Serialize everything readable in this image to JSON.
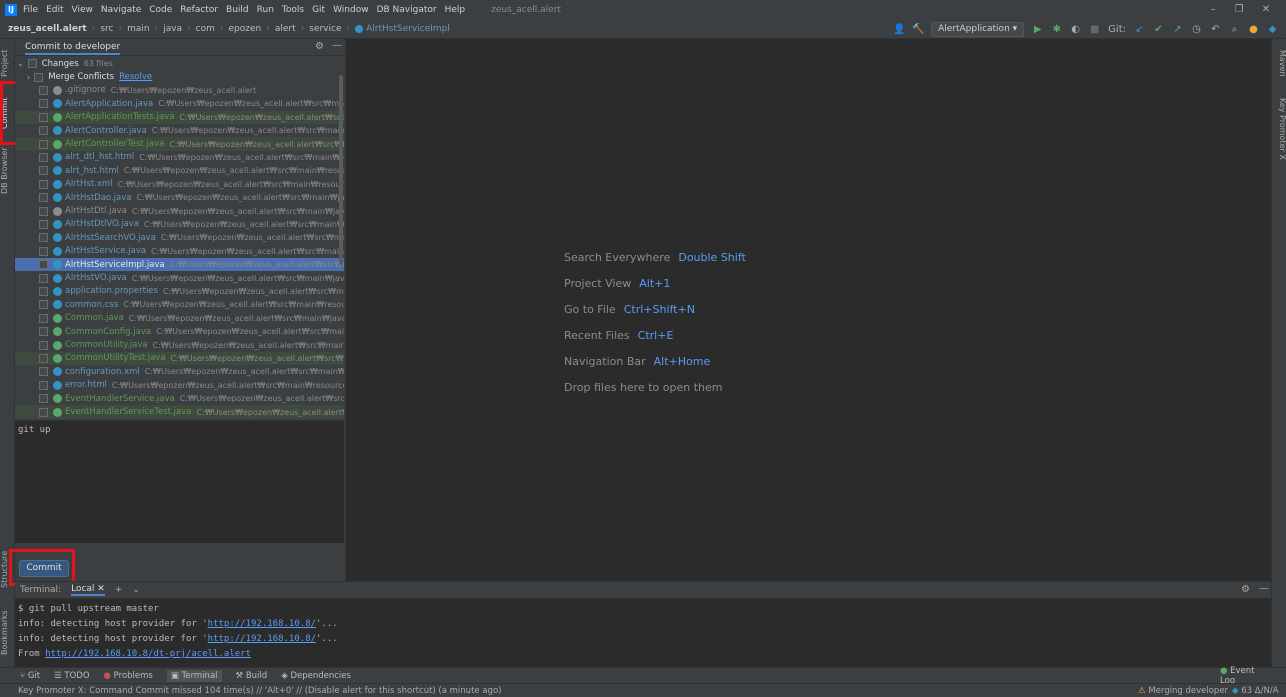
{
  "menubar": {
    "items": [
      "File",
      "Edit",
      "View",
      "Navigate",
      "Code",
      "Refactor",
      "Build",
      "Run",
      "Tools",
      "Git",
      "Window",
      "DB Navigator",
      "Help"
    ],
    "window_title": "zeus_acell.alert"
  },
  "breadcrumb": [
    "zeus_acell.alert",
    "src",
    "main",
    "java",
    "com",
    "epozen",
    "alert",
    "service",
    "AlrtHstServiceImpl"
  ],
  "toolbar": {
    "run_config": "AlertApplication",
    "git_label": "Git:"
  },
  "left_strip": {
    "project": "Project",
    "commit": "Commit",
    "db_browser": "DB Browser",
    "structure": "Structure",
    "bookmarks": "Bookmarks"
  },
  "right_strip": {
    "maven": "Maven",
    "key_promoter": "Key Promoter X"
  },
  "commit_panel": {
    "tab": "Commit to developer",
    "changes_label": "Changes",
    "changes_count": "63 files",
    "merge_conflicts": "Merge Conflicts",
    "resolve": "Resolve",
    "files": [
      {
        "name": ".gitignore",
        "path": "C:₩Users₩epozen₩zeus_acell.alert",
        "kind": "gray"
      },
      {
        "name": "AlertApplication.java",
        "path": "C:₩Users₩epozen₩zeus_acell.alert₩src₩main₩java₩com",
        "kind": "mod"
      },
      {
        "name": "AlertApplicationTests.java",
        "path": "C:₩Users₩epozen₩zeus_acell.alert₩src₩test₩java₩com",
        "kind": "added"
      },
      {
        "name": "AlertController.java",
        "path": "C:₩Users₩epozen₩zeus_acell.alert₩src₩main₩java₩com",
        "kind": "mod"
      },
      {
        "name": "AlertControllerTest.java",
        "path": "C:₩Users₩epozen₩zeus_acell.alert₩src₩test₩java₩com",
        "kind": "added"
      },
      {
        "name": "alrt_dtl_hst.html",
        "path": "C:₩Users₩epozen₩zeus_acell.alert₩src₩main₩resources₩tem",
        "kind": "mod"
      },
      {
        "name": "alrt_hst.html",
        "path": "C:₩Users₩epozen₩zeus_acell.alert₩src₩main₩resources₩templ",
        "kind": "mod"
      },
      {
        "name": "AlrtHst.xml",
        "path": "C:₩Users₩epozen₩zeus_acell.alert₩src₩main₩resources₩mybati",
        "kind": "mod"
      },
      {
        "name": "AlrtHstDao.java",
        "path": "C:₩Users₩epozen₩zeus_acell.alert₩src₩main₩java₩com₩ep",
        "kind": "mod"
      },
      {
        "name": "AlrtHstDtl.java",
        "path": "C:₩Users₩epozen₩zeus_acell.alert₩src₩main₩java₩com₩epo",
        "kind": "gray"
      },
      {
        "name": "AlrtHstDtlVO.java",
        "path": "C:₩Users₩epozen₩zeus_acell.alert₩src₩main₩java₩com₩ep",
        "kind": "mod"
      },
      {
        "name": "AlrtHstSearchVO.java",
        "path": "C:₩Users₩epozen₩zeus_acell.alert₩src₩main₩java₩com",
        "kind": "mod"
      },
      {
        "name": "AlrtHstService.java",
        "path": "C:₩Users₩epozen₩zeus_acell.alert₩src₩main₩java₩com₩",
        "kind": "mod"
      },
      {
        "name": "AlrtHstServiceImpl.java",
        "path": "C:₩Users₩epozen₩zeus_acell.alert₩src₩main₩java₩c",
        "kind": "mod"
      },
      {
        "name": "AlrtHstVO.java",
        "path": "C:₩Users₩epozen₩zeus_acell.alert₩src₩main₩java₩com₩epo",
        "kind": "mod"
      },
      {
        "name": "application.properties",
        "path": "C:₩Users₩epozen₩zeus_acell.alert₩src₩main₩resou",
        "kind": "mod"
      },
      {
        "name": "common.css",
        "path": "C:₩Users₩epozen₩zeus_acell.alert₩src₩main₩resources₩static",
        "kind": "mod"
      },
      {
        "name": "Common.java",
        "path": "C:₩Users₩epozen₩zeus_acell.alert₩src₩main₩java₩com₩epoz",
        "kind": "added"
      },
      {
        "name": "CommonConfig.java",
        "path": "C:₩Users₩epozen₩zeus_acell.alert₩src₩main₩java₩com",
        "kind": "added"
      },
      {
        "name": "CommonUtility.java",
        "path": "C:₩Users₩epozen₩zeus_acell.alert₩src₩main₩java₩com",
        "kind": "added"
      },
      {
        "name": "CommonUtilityTest.java",
        "path": "C:₩Users₩epozen₩zeus_acell.alert₩src₩test₩java₩co",
        "kind": "added"
      },
      {
        "name": "configuration.xml",
        "path": "C:₩Users₩epozen₩zeus_acell.alert₩src₩main₩resources₩",
        "kind": "mod"
      },
      {
        "name": "error.html",
        "path": "C:₩Users₩epozen₩zeus_acell.alert₩src₩main₩resources₩template",
        "kind": "mod"
      },
      {
        "name": "EventHandlerService.java",
        "path": "C:₩Users₩epozen₩zeus_acell.alert₩src₩main₩java₩",
        "kind": "added"
      },
      {
        "name": "EventHandlerServiceTest.java",
        "path": "C:₩Users₩epozen₩zeus_acell.alert₩src₩test₩java₩",
        "kind": "added"
      }
    ],
    "commit_message": "git up",
    "commit_button": "Commit"
  },
  "editor_hints": [
    {
      "label": "Search Everywhere",
      "key": "Double Shift"
    },
    {
      "label": "Project View",
      "key": "Alt+1"
    },
    {
      "label": "Go to File",
      "key": "Ctrl+Shift+N"
    },
    {
      "label": "Recent Files",
      "key": "Ctrl+E"
    },
    {
      "label": "Navigation Bar",
      "key": "Alt+Home"
    },
    {
      "label": "Drop files here to open them",
      "key": ""
    }
  ],
  "terminal": {
    "title": "Terminal:",
    "tab": "Local",
    "lines": [
      {
        "text": "$ git pull upstream master",
        "link": "",
        "suffix": ""
      },
      {
        "text": "info: detecting host provider for '",
        "link": "http://192.168.10.8/",
        "suffix": "'..."
      },
      {
        "text": "info: detecting host provider for '",
        "link": "http://192.168.10.8/",
        "suffix": "'..."
      },
      {
        "text": "From ",
        "link": "http://192.168.10.8/dt-prj/acell.alert",
        "suffix": ""
      }
    ]
  },
  "toolwindows": [
    "Git",
    "TODO",
    "Problems",
    "Terminal",
    "Build",
    "Dependencies"
  ],
  "event_log": "Event Log",
  "status": {
    "message": "Key Promoter X: Command Commit missed 104 time(s) // 'Alt+0' // (Disable alert for this shortcut) (a minute ago)",
    "branch": "Merging developer",
    "count": "63 Δ/N/A"
  }
}
